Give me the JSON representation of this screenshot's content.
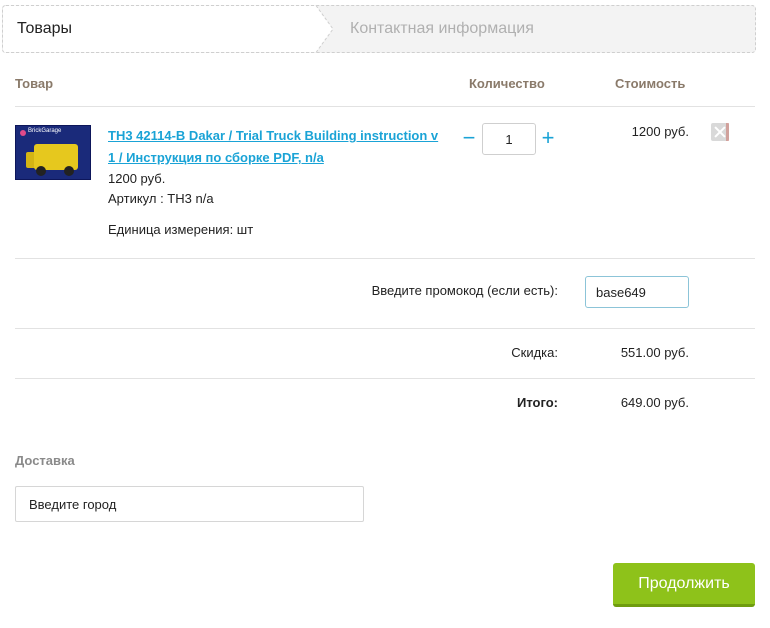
{
  "steps": {
    "active_label": "Товары",
    "next_label": "Контактная информация"
  },
  "table": {
    "header_product": "Товар",
    "header_qty": "Количество",
    "header_cost": "Стоимость"
  },
  "product": {
    "name": "TH3 42114-B Dakar / Trial Truck Building instruction v1 / Инструкция по сборке PDF, n/a",
    "price": "1200 руб.",
    "sku": "Артикул : TH3 n/a",
    "unit": "Единица измерения: шт",
    "quantity": "1",
    "cost": "1200 руб.",
    "thumb_logo": "BrickGarage",
    "qty_minus": "−",
    "qty_plus": "+"
  },
  "promo": {
    "label": "Введите промокод (если есть):",
    "value": "base649"
  },
  "summary": {
    "discount_label": "Скидка:",
    "discount_value": "551.00 руб.",
    "total_label": "Итого:",
    "total_value": "649.00 руб."
  },
  "delivery": {
    "title": "Доставка",
    "city_placeholder": "Введите город"
  },
  "actions": {
    "continue_label": "Продолжить"
  },
  "colors": {
    "accent_link": "#1aa3d6",
    "button_green": "#8ec21a",
    "header_text": "#8a7a6a"
  }
}
